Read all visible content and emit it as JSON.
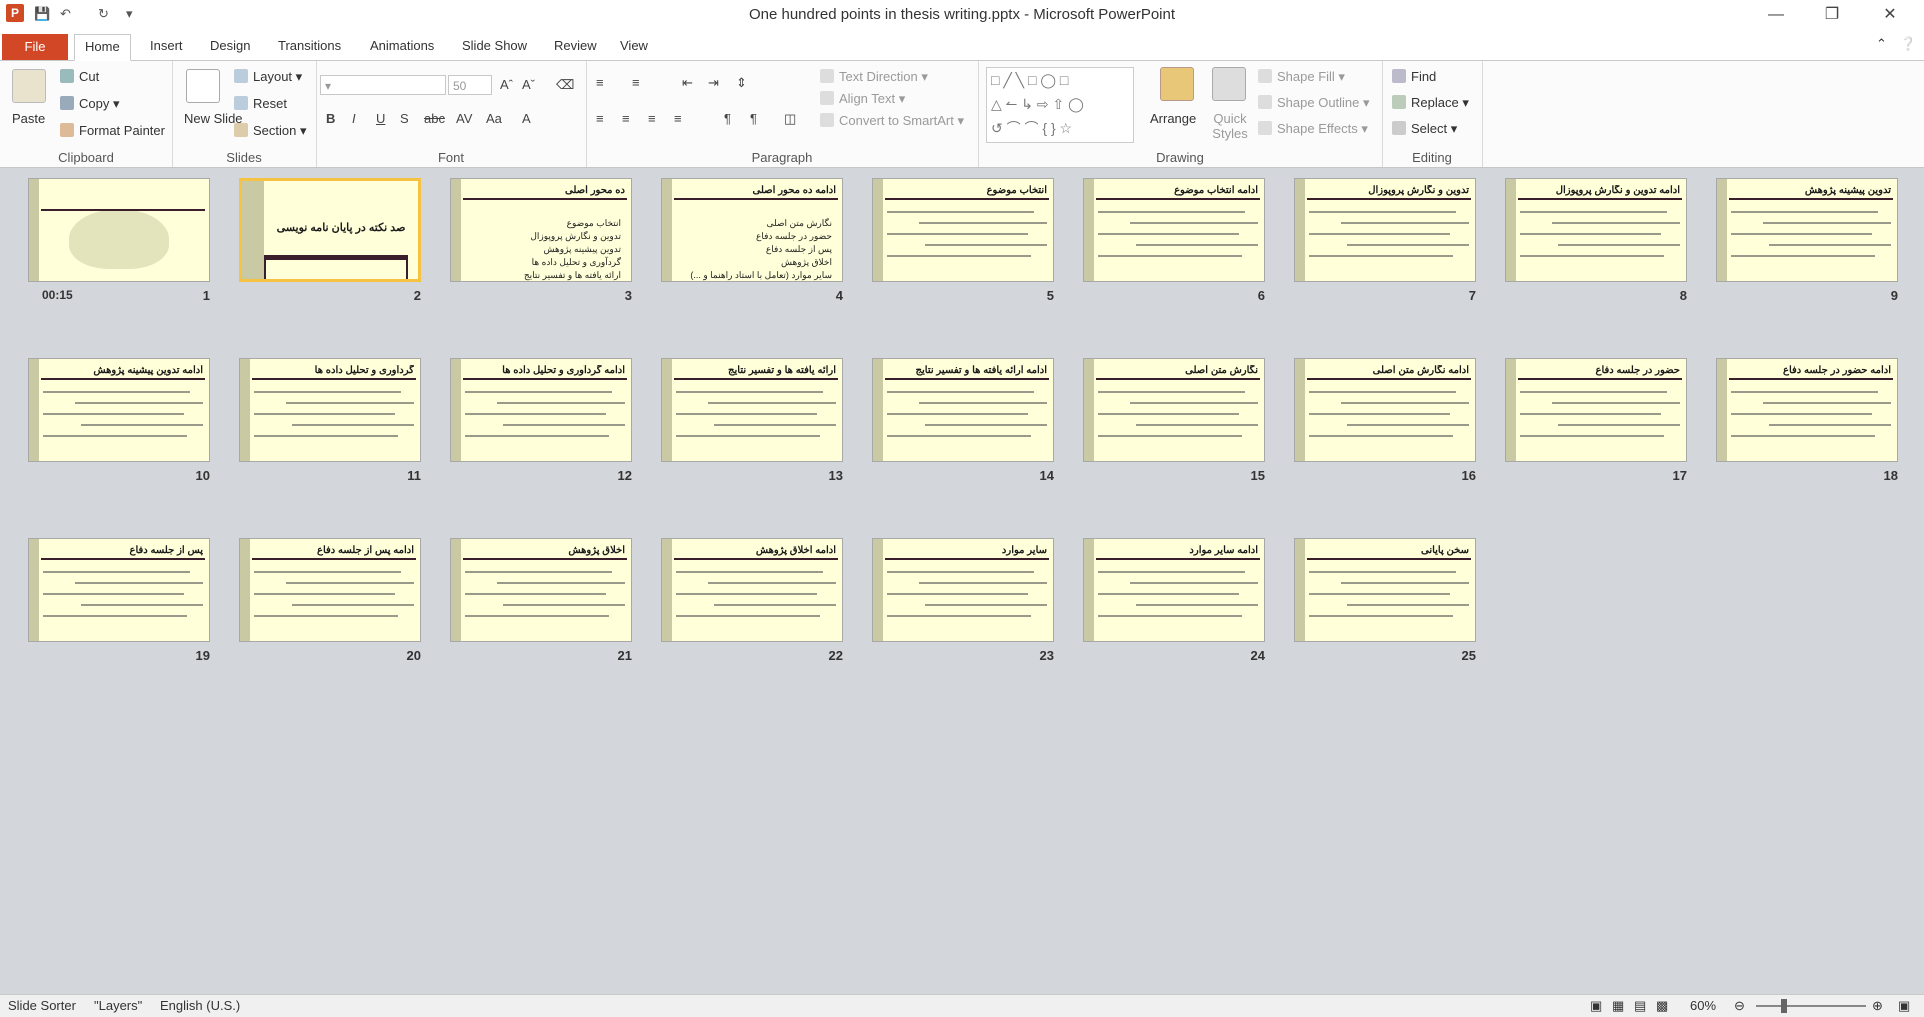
{
  "window": {
    "title": "One hundred points in thesis writing.pptx - Microsoft PowerPoint"
  },
  "tabs": [
    "File",
    "Home",
    "Insert",
    "Design",
    "Transitions",
    "Animations",
    "Slide Show",
    "Review",
    "View"
  ],
  "active_tab": "Home",
  "ribbon": {
    "clipboard": {
      "label": "Clipboard",
      "paste": "Paste",
      "cut": "Cut",
      "copy": "Copy",
      "format_painter": "Format Painter"
    },
    "slides": {
      "label": "Slides",
      "new_slide": "New Slide",
      "layout": "Layout",
      "reset": "Reset",
      "section": "Section"
    },
    "font": {
      "label": "Font",
      "size": "50"
    },
    "paragraph": {
      "label": "Paragraph",
      "text_direction": "Text Direction",
      "align_text": "Align Text",
      "convert_smartart": "Convert to SmartArt"
    },
    "drawing": {
      "label": "Drawing",
      "arrange": "Arrange",
      "quick_styles": "Quick Styles",
      "shape_fill": "Shape Fill",
      "shape_outline": "Shape Outline",
      "shape_effects": "Shape Effects"
    },
    "editing": {
      "label": "Editing",
      "find": "Find",
      "replace": "Replace",
      "select": "Select"
    }
  },
  "slides": [
    {
      "num": "1",
      "title": "",
      "timing": "00:15"
    },
    {
      "num": "2",
      "title": "صد نکته در پایان نامه نویسی"
    },
    {
      "num": "3",
      "title": "ده محور اصلی",
      "items": [
        "انتخاب موضوع",
        "تدوین و نگارش پروپوزال",
        "تدوین پیشینه پژوهش",
        "گردآوری و تحلیل داده ها",
        "ارائه یافته ها و تفسیر نتایج"
      ]
    },
    {
      "num": "4",
      "title": "ادامه ده محور اصلی",
      "items": [
        "نگارش متن اصلی",
        "حضور در جلسه دفاع",
        "پس از جلسه دفاع",
        "اخلاق پژوهش",
        "سایر موارد (تعامل با استاد راهنما و ...)"
      ]
    },
    {
      "num": "5",
      "title": "انتخاب موضوع"
    },
    {
      "num": "6",
      "title": "ادامه انتخاب موضوع"
    },
    {
      "num": "7",
      "title": "تدوین و نگارش پروپوزال"
    },
    {
      "num": "8",
      "title": "ادامه تدوین و نگارش پروپوزال"
    },
    {
      "num": "9",
      "title": "تدوین پیشینه پژوهش"
    },
    {
      "num": "10",
      "title": "ادامه تدوین پیشینه پژوهش"
    },
    {
      "num": "11",
      "title": "گردآوری و تحلیل داده ها"
    },
    {
      "num": "12",
      "title": "ادامه گردآوری و تحلیل داده ها"
    },
    {
      "num": "13",
      "title": "ارائه یافته ها و تفسیر نتایج"
    },
    {
      "num": "14",
      "title": "ادامه ارائه یافته ها و تفسیر نتایج"
    },
    {
      "num": "15",
      "title": "نگارش متن اصلی"
    },
    {
      "num": "16",
      "title": "ادامه نگارش متن اصلی"
    },
    {
      "num": "17",
      "title": "حضور در جلسه دفاع"
    },
    {
      "num": "18",
      "title": "ادامه حضور در جلسه دفاع"
    },
    {
      "num": "19",
      "title": "پس از جلسه دفاع"
    },
    {
      "num": "20",
      "title": "ادامه پس از جلسه دفاع"
    },
    {
      "num": "21",
      "title": "اخلاق پژوهش"
    },
    {
      "num": "22",
      "title": "ادامه اخلاق پژوهش"
    },
    {
      "num": "23",
      "title": "سایر موارد"
    },
    {
      "num": "24",
      "title": "ادامه سایر موارد"
    },
    {
      "num": "25",
      "title": "سخن پایانی"
    }
  ],
  "statusbar": {
    "view": "Slide Sorter",
    "theme": "\"Layers\"",
    "language": "English (U.S.)",
    "zoom": "60%"
  }
}
